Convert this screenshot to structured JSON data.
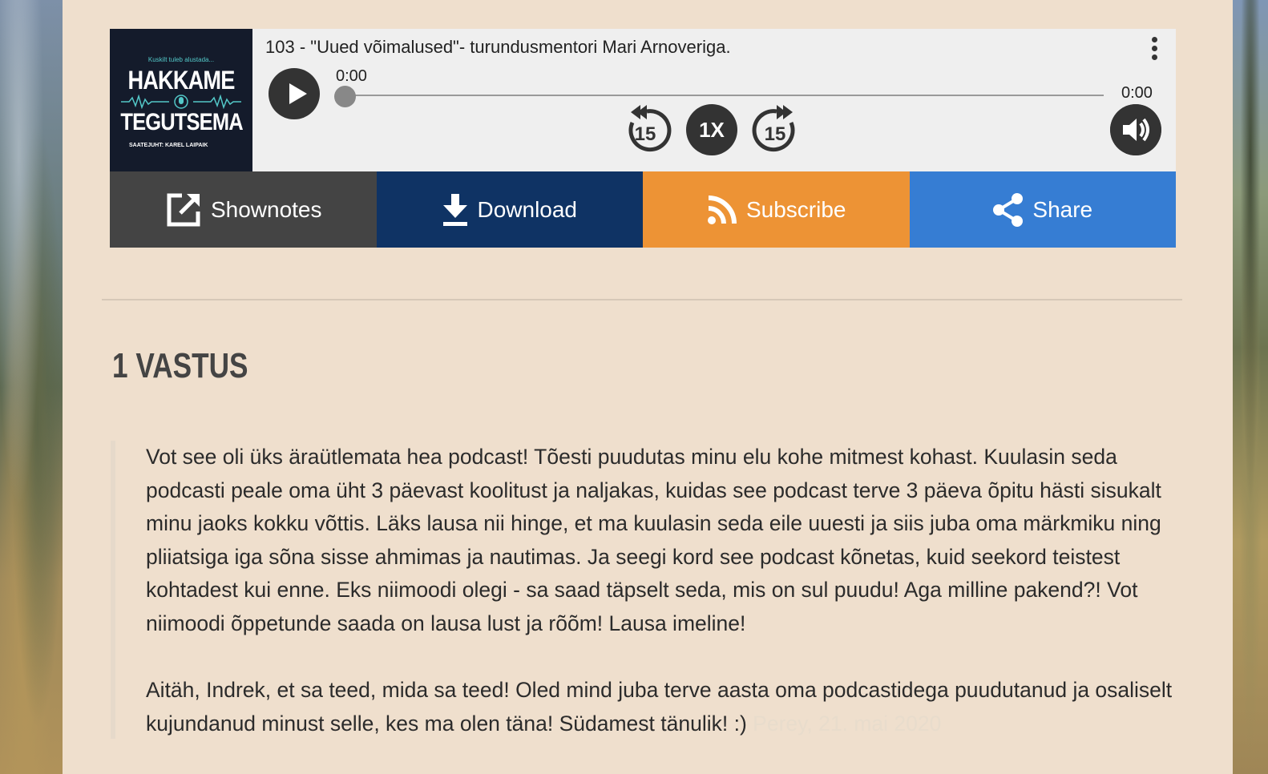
{
  "player": {
    "episode_title": "103 - \"Uued võimalused\"- turundusmentori Mari Arnoveriga.",
    "current_time": "0:00",
    "total_time": "0:00",
    "speed": "1X",
    "skip_back": "15",
    "skip_forward": "15",
    "progress": 0,
    "cover": {
      "tagline": "Kuskilt tuleb alustada...",
      "title_line1": "HAKKAME",
      "title_line2": "TEGUTSEMA",
      "host": "SAATEJUHT: KAREL LAIPAIK"
    },
    "buttons": {
      "shownotes": "Shownotes",
      "download": "Download",
      "subscribe": "Subscribe",
      "share": "Share"
    }
  },
  "comments": {
    "title": "1 VASTUS",
    "items": [
      {
        "paragraph1": "Vot see oli üks äraütlematа hea podcast! Tõesti puudutas minu elu kohe mitmest kohast. Kuulasin seda podcasti peale oma üht 3 päevast koolitust ja naljakas, kuidas see podcast terve 3 päeva õpitu hästi sisukalt minu jaoks kokku võttis. Läks lausa nii hinge, et ma kuulasin seda eile uuesti ja siis juba oma märkmiku ning pliiatsiga iga sõna sisse ahmimas ja nautimas. Ja seegi kord see podcast kõnetas, kuid seekord teistest kohtadest kui enne. Eks niimoodi olegi - sa saad täpselt seda, mis on sul puudu! Aga milline pakend?! Vot niimoodi õppetunde saada on lausa lust ja rõõm! Lausa imeline!",
        "paragraph2": "Aitäh, Indrek, et sa teed, mida sa teed! Oled mind juba terve aasta oma podcastidega puudutanud ja osaliselt kujundanud minust selle, kes ma olen täna! Südamest tänulik! :)",
        "meta": "Perey, 21. mai 2020"
      }
    ]
  },
  "colors": {
    "panel": "#efdfcd",
    "shownotes": "#444444",
    "download": "#0f3364",
    "subscribe": "#ed9335",
    "share": "#367dd3"
  }
}
